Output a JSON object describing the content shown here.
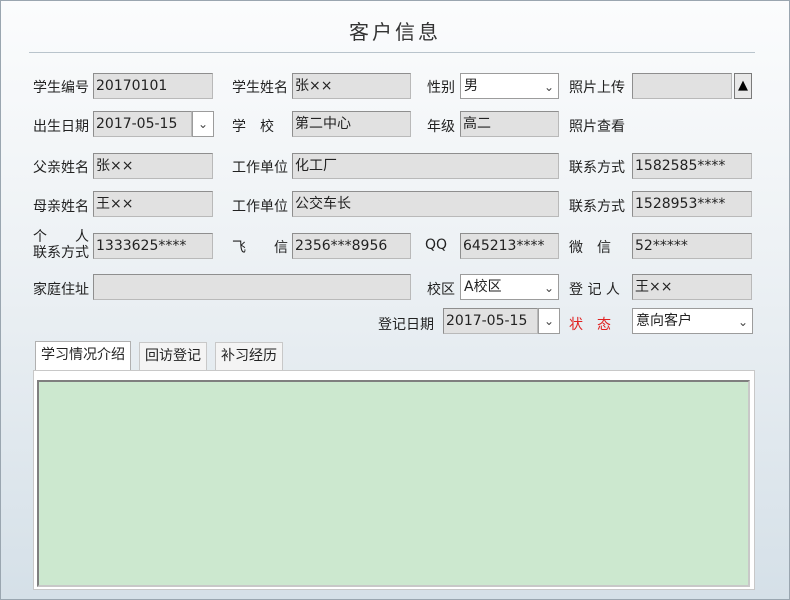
{
  "title": "客户信息",
  "labels": {
    "student_id": "学生编号",
    "student_name": "学生姓名",
    "gender": "性别",
    "photo_upload": "照片上传",
    "birth_date": "出生日期",
    "school": "学　校",
    "grade": "年级",
    "photo_view": "照片查看",
    "father_name": "父亲姓名",
    "father_work": "工作单位",
    "father_contact": "联系方式",
    "mother_name": "母亲姓名",
    "mother_work": "工作单位",
    "mother_contact": "联系方式",
    "personal_line1": "个　　人",
    "personal_line2": "联系方式",
    "feixin": "飞　　信",
    "qq": "QQ",
    "wechat": "微　信",
    "home_address": "家庭住址",
    "campus": "校区",
    "registrar": "登 记 人",
    "register_date": "登记日期",
    "status": "状　态"
  },
  "values": {
    "student_id": "20170101",
    "student_name": "张××",
    "gender": "男",
    "photo_upload": "",
    "birth_date": "2017-05-15",
    "school": "第二中心",
    "grade": "高二",
    "father_name": "张××",
    "father_work": "化工厂",
    "father_contact": "1582585****",
    "mother_name": "王××",
    "mother_work": "公交车长",
    "mother_contact": "1528953****",
    "personal_contact": "1333625****",
    "feixin": "2356***8956",
    "qq": "645213****",
    "wechat": "52*****",
    "home_address": "",
    "campus": "A校区",
    "registrar": "王××",
    "register_date": "2017-05-15",
    "status": "意向客户"
  },
  "icons": {
    "dropdown": "chevron-down-icon",
    "upload": "triangle-up-icon"
  },
  "tabs": [
    "学习情况介绍",
    "回访登记",
    "补习经历"
  ],
  "notes": "",
  "colors": {
    "status_label": "#e02020",
    "notes_background": "#cce8cf"
  }
}
